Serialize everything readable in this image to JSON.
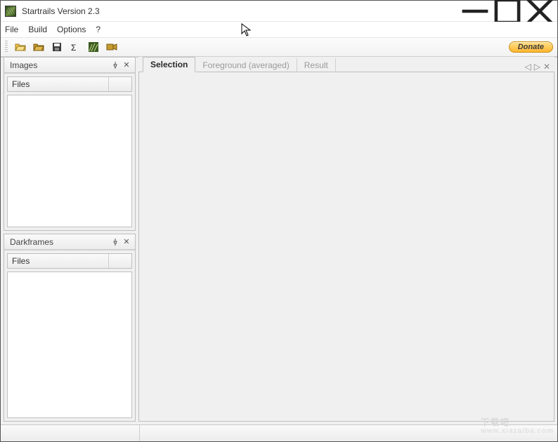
{
  "window": {
    "title": "Startrails Version 2.3"
  },
  "menu": {
    "file": "File",
    "build": "Build",
    "options": "Options",
    "help": "?"
  },
  "toolbar": {
    "donate": "Donate"
  },
  "panels": {
    "images": {
      "title": "Images",
      "column": "Files"
    },
    "darkframes": {
      "title": "Darkframes",
      "column": "Files"
    }
  },
  "tabs": {
    "selection": "Selection",
    "foreground": "Foreground (averaged)",
    "result": "Result"
  },
  "watermark": {
    "main": "下载吧",
    "sub": "www.xiazaiba.com"
  }
}
